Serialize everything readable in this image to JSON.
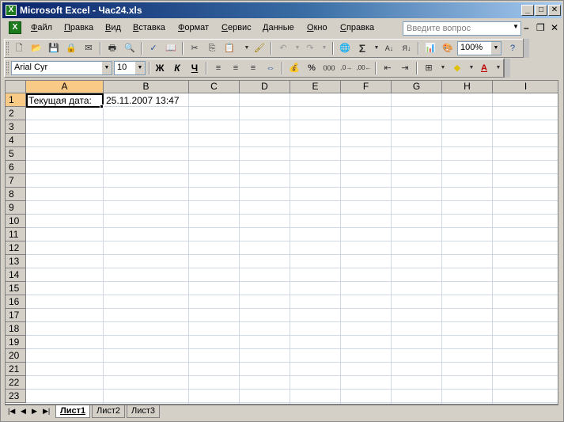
{
  "window": {
    "title": "Microsoft Excel - Час24.xls"
  },
  "menu": {
    "items": [
      "Файл",
      "Правка",
      "Вид",
      "Вставка",
      "Формат",
      "Сервис",
      "Данные",
      "Окно",
      "Справка"
    ],
    "help_placeholder": "Введите вопрос"
  },
  "toolbar": {
    "zoom": "100%",
    "font_name": "Arial Cyr",
    "font_size": "10",
    "bold": "Ж",
    "italic": "К",
    "underline": "Ч",
    "percent": "%",
    "thousands": "000",
    "autosum": "Σ"
  },
  "grid": {
    "columns": [
      "A",
      "B",
      "C",
      "D",
      "E",
      "F",
      "G",
      "H",
      "I"
    ],
    "rows": [
      "1",
      "2",
      "3",
      "4",
      "5",
      "6",
      "7",
      "8",
      "9",
      "10",
      "11",
      "12",
      "13",
      "14",
      "15",
      "16",
      "17",
      "18",
      "19",
      "20",
      "21",
      "22",
      "23"
    ],
    "active_cell": "A1",
    "cells": {
      "A1": "Текущая дата:",
      "B1": "25.11.2007 13:47"
    }
  },
  "sheets": [
    "Лист1",
    "Лист2",
    "Лист3"
  ],
  "active_sheet": "Лист1",
  "colors": {
    "title_start": "#0a246a",
    "title_end": "#a6caf0",
    "header_active": "#f9c986",
    "gridline": "#d0d7e5"
  }
}
